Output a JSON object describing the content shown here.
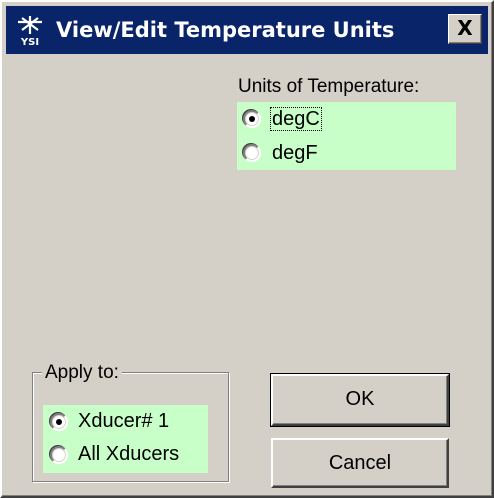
{
  "window": {
    "title": "View/Edit Temperature Units",
    "close_glyph": "X",
    "app_icon": "ysi-logo-icon",
    "app_icon_text": "YSI"
  },
  "units": {
    "label": "Units of Temperature:",
    "options": [
      {
        "label": "degC",
        "selected": true
      },
      {
        "label": "degF",
        "selected": false
      }
    ]
  },
  "apply": {
    "legend": "Apply to:",
    "options": [
      {
        "label": "Xducer# 1",
        "selected": true
      },
      {
        "label": "All Xducers",
        "selected": false
      }
    ]
  },
  "buttons": {
    "ok": "OK",
    "cancel": "Cancel"
  },
  "colors": {
    "titlebar": "#0a246a",
    "highlight_panel": "#c8ffc8",
    "dialog_bg": "#d4d0c8"
  }
}
